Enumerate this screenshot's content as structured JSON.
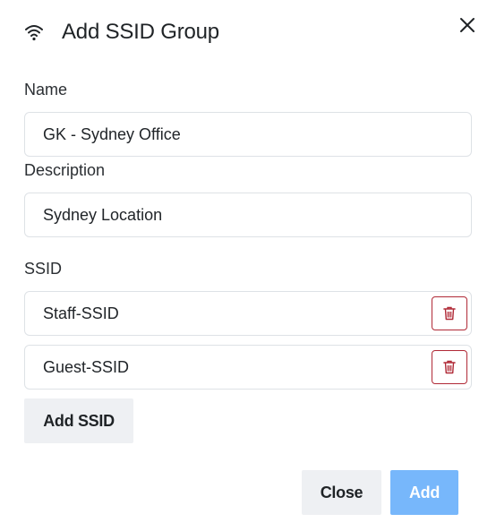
{
  "dialog": {
    "title": "Add SSID Group",
    "header_icon": "wifi-icon",
    "close_icon": "close-icon"
  },
  "form": {
    "name_label": "Name",
    "name_value": "GK - Sydney Office",
    "description_label": "Description",
    "description_value": "Sydney Location",
    "ssid_label": "SSID",
    "ssids": [
      {
        "value": "Staff-SSID",
        "delete_icon": "trash-icon"
      },
      {
        "value": "Guest-SSID",
        "delete_icon": "trash-icon"
      }
    ],
    "add_ssid_label": "Add SSID"
  },
  "footer": {
    "close_label": "Close",
    "add_label": "Add"
  },
  "colors": {
    "primary_disabled": "#77b7fb",
    "danger": "#b02a37",
    "secondary_bg": "#eef0f3",
    "border": "#dee2e6"
  }
}
